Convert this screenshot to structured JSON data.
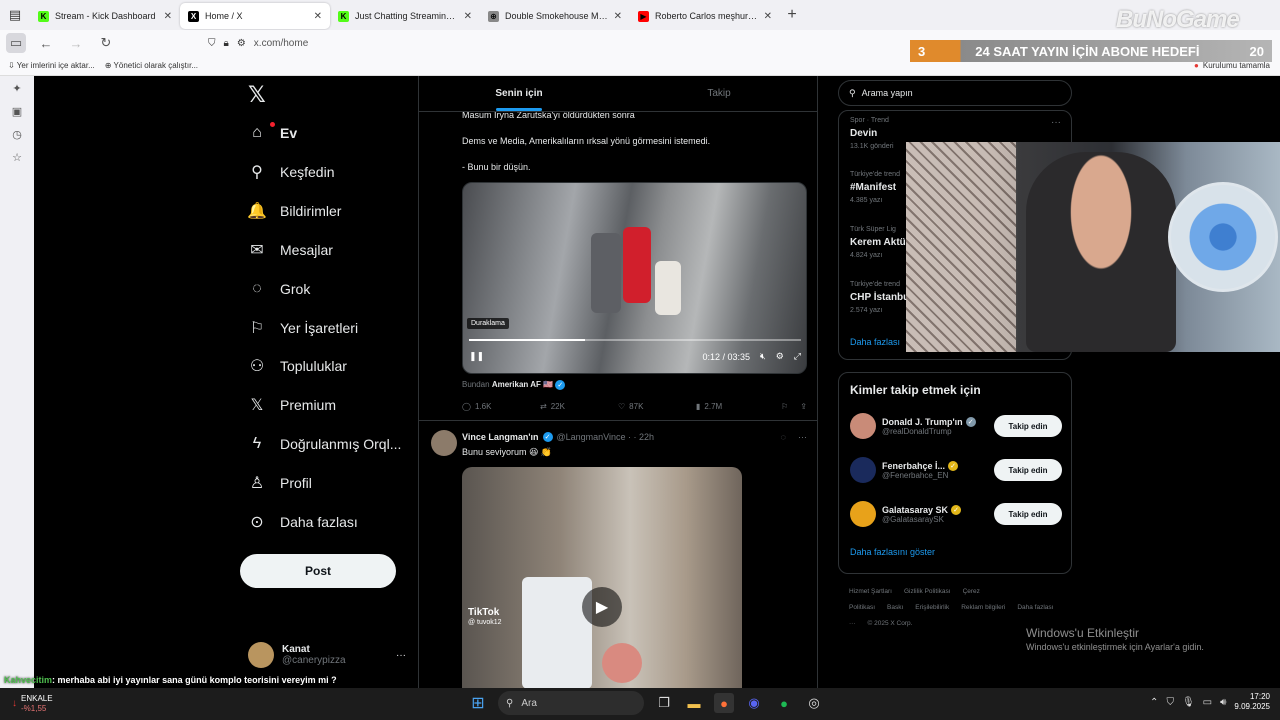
{
  "browser": {
    "tabs": [
      {
        "title": "Stream - Kick Dashboard",
        "favicon_color": "#53fc18",
        "favicon_glyph": "K",
        "active": false
      },
      {
        "title": "Home / X",
        "favicon_color": "#000000",
        "favicon_glyph": "X",
        "active": true
      },
      {
        "title": "Just Chatting Streaming - Live S",
        "favicon_color": "#53fc18",
        "favicon_glyph": "K",
        "active": false
      },
      {
        "title": "Double Smokehouse Menü Kald",
        "favicon_color": "#888888",
        "favicon_glyph": "⊕",
        "active": false
      },
      {
        "title": "Roberto Carlos meşhur vuruşu",
        "favicon_color": "#ff0000",
        "favicon_glyph": "▶",
        "active": false
      }
    ],
    "url": "x.com/home",
    "bookmarks": [
      {
        "label": "Yer imlerini içe aktar..."
      },
      {
        "label": "Yönetici olarak çalıştır..."
      }
    ],
    "bookmark_right": "Kurulumu tamamla"
  },
  "x": {
    "nav": [
      {
        "label": "Ev",
        "icon": "home-icon",
        "glyph": "⌂",
        "bold": true
      },
      {
        "label": "Keşfedin",
        "icon": "search-icon",
        "glyph": "⚲"
      },
      {
        "label": "Bildirimler",
        "icon": "bell-icon",
        "glyph": "🔔"
      },
      {
        "label": "Mesajlar",
        "icon": "mail-icon",
        "glyph": "✉"
      },
      {
        "label": "Grok",
        "icon": "grok-icon",
        "glyph": "◌"
      },
      {
        "label": "Yer İşaretleri",
        "icon": "bookmark-icon",
        "glyph": "⚐"
      },
      {
        "label": "Topluluklar",
        "icon": "communities-icon",
        "glyph": "⚇"
      },
      {
        "label": "Premium",
        "icon": "x-premium-icon",
        "glyph": "𝕏"
      },
      {
        "label": "Doğrulanmış Orql...",
        "icon": "lightning-icon",
        "glyph": "ϟ"
      },
      {
        "label": "Profil",
        "icon": "profile-icon",
        "glyph": "♙"
      },
      {
        "label": "Daha fazlası",
        "icon": "more-circle-icon",
        "glyph": "⊙"
      }
    ],
    "post_label": "Post",
    "profile": {
      "name": "Kanat",
      "handle": "@canerypizza"
    },
    "tabs": {
      "for_you": "Senin için",
      "following": "Takip"
    },
    "tweet1": {
      "line1": "Masum Iryna Zarutska'yı öldürdükten sonra",
      "line2": "Dems ve Media, Amerikalıların ırksal yönü görmesini istemedi.",
      "line3": "- Bunu bir düşün.",
      "tooltip": "Duraklama",
      "time": "0:12 / 03:35",
      "progress": 0.35,
      "from_prefix": "Bundan",
      "from_name": "Amerikan AF 🇺🇸",
      "replies": "1.6K",
      "reposts": "22K",
      "likes": "87K",
      "views": "2.7M"
    },
    "tweet2": {
      "name": "Vince Langman'ın",
      "handle": "@LangmanVince · · 22h",
      "text": "Bunu seviyorum 😆 👏",
      "tiktok": "TikTok",
      "tiktok_user": "@ tuvok12"
    },
    "search_placeholder": "Arama yapın",
    "trends": [
      {
        "category": "Spor · Trend",
        "title": "Devin",
        "count": "13.1K gönderi"
      },
      {
        "category": "Türkiye'de trend",
        "title": "#Manifest",
        "count": "4.385 yazı"
      },
      {
        "category": "Türk Süper Lig",
        "title": "Kerem Aktü",
        "count": "4.824 yazı"
      },
      {
        "category": "Türkiye'de trend",
        "title": "CHP İstanbu",
        "count": "2.574 yazı"
      }
    ],
    "trends_more": "Daha fazlası",
    "who_to_follow": {
      "title": "Kimler takip etmek için",
      "accounts": [
        {
          "name": "Donald J. Trump'ın",
          "handle": "@realDonaldTrump",
          "badge": "gray",
          "avatar_color": "#c98b78"
        },
        {
          "name": "Fenerbahçe İ...",
          "handle": "@Fenerbahce_EN",
          "badge": "gold",
          "avatar_color": "#1a2a5c"
        },
        {
          "name": "Galatasaray SK",
          "handle": "@GalatasaraySK",
          "badge": "gold",
          "avatar_color": "#e8a21a"
        }
      ],
      "follow_label": "Takip edin",
      "more": "Daha fazlasını göster"
    },
    "footer": [
      "Hizmet Şartları",
      "Gizlilik Politikası",
      "Çerez Politikası",
      "Baskı",
      "Erişilebilirlik",
      "Reklam bilgileri",
      "Daha fazlası ···",
      "© 2025 X Corp."
    ]
  },
  "stream": {
    "goal_count": "3",
    "goal_title": "24 SAAT YAYIN İÇİN ABONE HEDEFİ",
    "goal_target": "20",
    "watermark": "BuNoGame",
    "chat_user": "Kahvecitim",
    "chat_text": ": merhaba abi iyi yayınlar sana günü komplo teorisini vereyim mi ?"
  },
  "windows": {
    "activate_title": "Windows'u Etkinleştir",
    "activate_sub": "Windows'u etkinleştirmek için Ayarlar'a gidin.",
    "stock_name": "ENKALE",
    "stock_delta": "-%1,55",
    "search_label": "Ara",
    "time": "17:20",
    "date": "9.09.2025"
  }
}
